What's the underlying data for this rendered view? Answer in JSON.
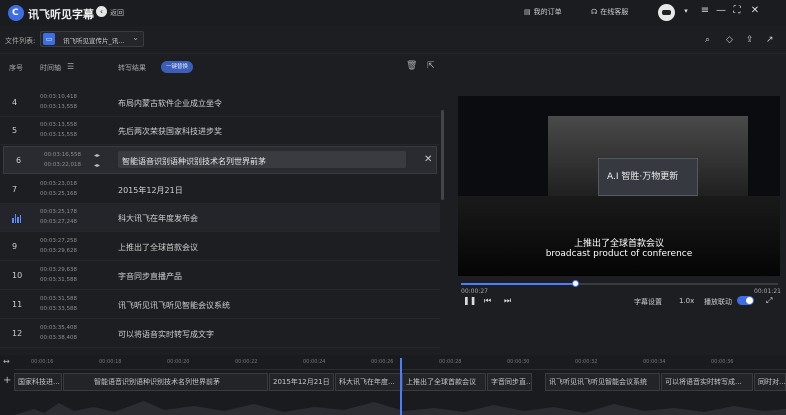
{
  "app": {
    "title": "讯飞听见字幕",
    "logo_glyph": "C",
    "back_label": "返回",
    "my_orders": "我的订单",
    "online_service": "在线客服"
  },
  "filebar": {
    "label": "文件列表:",
    "file_name": "讯飞听见宣传片_讯..."
  },
  "list": {
    "headers": {
      "index": "序号",
      "time": "时间轴",
      "result": "转写结果"
    },
    "one_key_btn": "一键替换",
    "rows": [
      {
        "num": "4",
        "start": "00:03:10,418",
        "end": "00:03:13,558",
        "text": "布局内蒙古软件企业成立坐令"
      },
      {
        "num": "5",
        "start": "00:03:13,558",
        "end": "00:03:15,558",
        "text": "先后两次荣获国家科技进步奖"
      },
      {
        "num": "6",
        "start": "00:03:16,558",
        "end": "00:03:22,018",
        "text": "智能语音识别语种识别技术名列世界前茅"
      },
      {
        "num": "7",
        "start": "00:03:23,018",
        "end": "00:03:25,168",
        "text": "2015年12月21日"
      },
      {
        "num": "8",
        "start": "00:03:25,178",
        "end": "00:03:27,248",
        "text": "科大讯飞在年度发布会"
      },
      {
        "num": "9",
        "start": "00:03:27,258",
        "end": "00:03:29,628",
        "text": "上推出了全球首款会议"
      },
      {
        "num": "10",
        "start": "00:03:29,638",
        "end": "00:03:31,588",
        "text": "字音同步直播产品"
      },
      {
        "num": "11",
        "start": "00:03:31,588",
        "end": "00:03:33,588",
        "text": "讯飞听见讯飞听见智能会议系统"
      },
      {
        "num": "12",
        "start": "00:03:35,408",
        "end": "00:03:38,408",
        "text": "可以将语音实时转写成文字"
      }
    ]
  },
  "player": {
    "screen_text": "A.I 智胜·万物更新",
    "subtitle_zh": "上推出了全球首款会议",
    "subtitle_en": "broadcast product of conference",
    "current_time": "00:00:27",
    "total_time": "00:01:21",
    "progress": 0.36,
    "subtitle_settings": "字幕设置",
    "speed": "1.0x",
    "linked_label": "播放联动"
  },
  "timeline": {
    "ticks": [
      "00:00:16",
      "00:00:18",
      "00:00:20",
      "00:00:22",
      "00:00:24",
      "00:00:26",
      "00:00:28",
      "00:00:30",
      "00:00:32",
      "00:00:34",
      "00:00:36"
    ],
    "segments": [
      "国家科技进...",
      "智能语音识别语种识别技术名列世界前茅",
      "2015年12月21日",
      "科大讯飞在年度...",
      "上推出了全球首款会议",
      "字音同步直...",
      "讯飞听见讯飞听见智能会议系统",
      "可以将语音实时转写成...",
      "同时对..."
    ]
  },
  "colors": {
    "accent": "#3d6ee6",
    "bg": "#1d1e22"
  }
}
